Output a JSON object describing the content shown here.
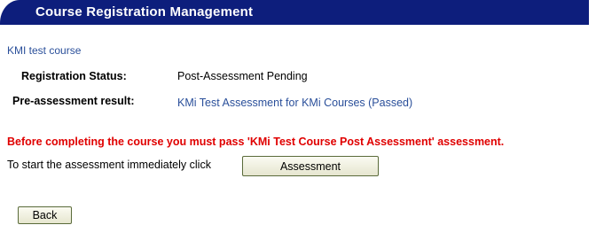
{
  "header": {
    "title": "Course Registration Management"
  },
  "course": {
    "name": "KMI test course"
  },
  "details": {
    "registration_status_label": "Registration Status:",
    "registration_status_value": "Post-Assessment Pending",
    "pre_assessment_label": "Pre-assessment result:",
    "pre_assessment_value": "KMi Test Assessment for KMi Courses (Passed)"
  },
  "notice": {
    "warning": "Before completing the course you must pass 'KMi Test Course Post Assessment' assessment.",
    "start_text": "To start the assessment immediately click",
    "assessment_button": "Assessment"
  },
  "footer": {
    "back_button": "Back"
  },
  "colors": {
    "header_bg": "#0d1e7c",
    "link": "#2a4f9a",
    "warning": "#e00000"
  }
}
